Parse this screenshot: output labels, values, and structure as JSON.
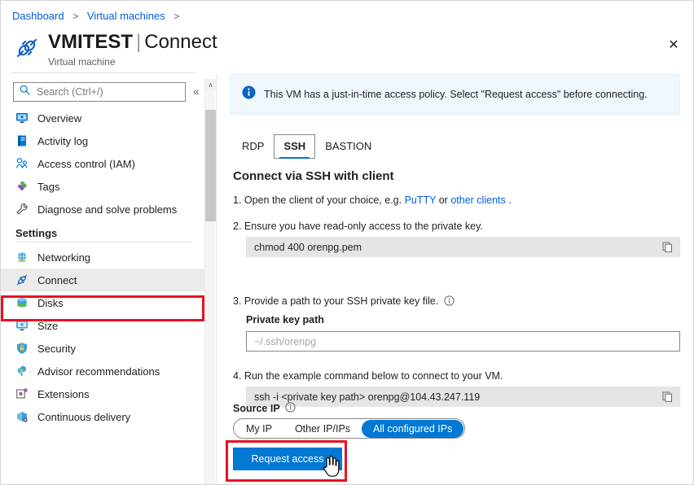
{
  "breadcrumb": {
    "items": [
      "Dashboard",
      "Virtual machines"
    ],
    "separator": ">"
  },
  "header": {
    "vm_name": "VMITEST",
    "separator": "|",
    "page": "Connect",
    "subtitle": "Virtual machine",
    "icon": "connect-plug-icon",
    "close_label": "✕"
  },
  "sidebar": {
    "search": {
      "placeholder": "Search (Ctrl+/)",
      "value": "",
      "icon": "search-icon"
    },
    "collapse_icon": "«",
    "items": [
      {
        "label": "Overview",
        "icon": "overview-monitor-icon",
        "selected": false
      },
      {
        "label": "Activity log",
        "icon": "activity-log-icon",
        "selected": false
      },
      {
        "label": "Access control (IAM)",
        "icon": "access-control-people-icon",
        "selected": false
      },
      {
        "label": "Tags",
        "icon": "tags-icon",
        "selected": false
      },
      {
        "label": "Diagnose and solve problems",
        "icon": "diagnose-wrench-icon",
        "selected": false
      }
    ],
    "section_title": "Settings",
    "settings_items": [
      {
        "label": "Networking",
        "icon": "networking-globe-icon",
        "selected": false
      },
      {
        "label": "Connect",
        "icon": "connect-plug-icon",
        "selected": true
      },
      {
        "label": "Disks",
        "icon": "disks-icon",
        "selected": false
      },
      {
        "label": "Size",
        "icon": "size-monitor-icon",
        "selected": false
      },
      {
        "label": "Security",
        "icon": "security-shield-lock-icon",
        "selected": false
      },
      {
        "label": "Advisor recommendations",
        "icon": "advisor-icon",
        "selected": false
      },
      {
        "label": "Extensions",
        "icon": "extensions-icon",
        "selected": false
      },
      {
        "label": "Continuous delivery",
        "icon": "continuous-delivery-icon",
        "selected": false
      }
    ],
    "scrollbar": {
      "up_arrow": "∧"
    }
  },
  "main": {
    "banner": {
      "icon": "info-filled-icon",
      "text": "This VM has a just-in-time access policy. Select \"Request access\" before connecting."
    },
    "tabs": [
      {
        "label": "RDP",
        "active": false
      },
      {
        "label": "SSH",
        "active": true
      },
      {
        "label": "BASTION",
        "active": false
      }
    ],
    "section_title": "Connect via SSH with client",
    "steps": {
      "step1": {
        "number": "1.",
        "text_before": "Open the client of your choice, e.g.",
        "link1": "PuTTY",
        "text_middle": "or",
        "link2": "other clients",
        "text_after": "."
      },
      "step2": {
        "number": "2.",
        "text": "Ensure you have read-only access to the private key.",
        "command": "chmod 400 orenpg.pem",
        "copy_icon": "copy-icon"
      },
      "step3": {
        "number": "3.",
        "text": "Provide a path to your SSH private key file.",
        "info_icon": "info-outline-icon",
        "field_label": "Private key path",
        "field_placeholder": "~/.ssh/orenpg",
        "field_value": ""
      },
      "step4": {
        "number": "4.",
        "text": "Run the example command below to connect to your VM.",
        "command": "ssh -i <private key path> orenpg@104.43.247.119",
        "copy_icon": "copy-icon"
      }
    },
    "source_ip": {
      "label": "Source IP",
      "info_icon": "info-outline-icon",
      "options": [
        {
          "label": "My IP",
          "selected": false
        },
        {
          "label": "Other IP/IPs",
          "selected": false
        },
        {
          "label": "All configured IPs",
          "selected": true
        }
      ]
    },
    "request_button": {
      "label": "Request access"
    }
  },
  "annotations": {
    "highlight_color": "#e81123",
    "boxes": [
      "connect-sidebar-item",
      "request-access-button"
    ],
    "cursor": "pointing-hand-cursor"
  },
  "colors": {
    "accent_blue": "#0078d4",
    "link_blue": "#015cda",
    "banner_bg": "#eff6fc",
    "selected_nav_bg": "#edebe9",
    "code_bg": "#e5e5e5",
    "highlight_red": "#e81123"
  }
}
